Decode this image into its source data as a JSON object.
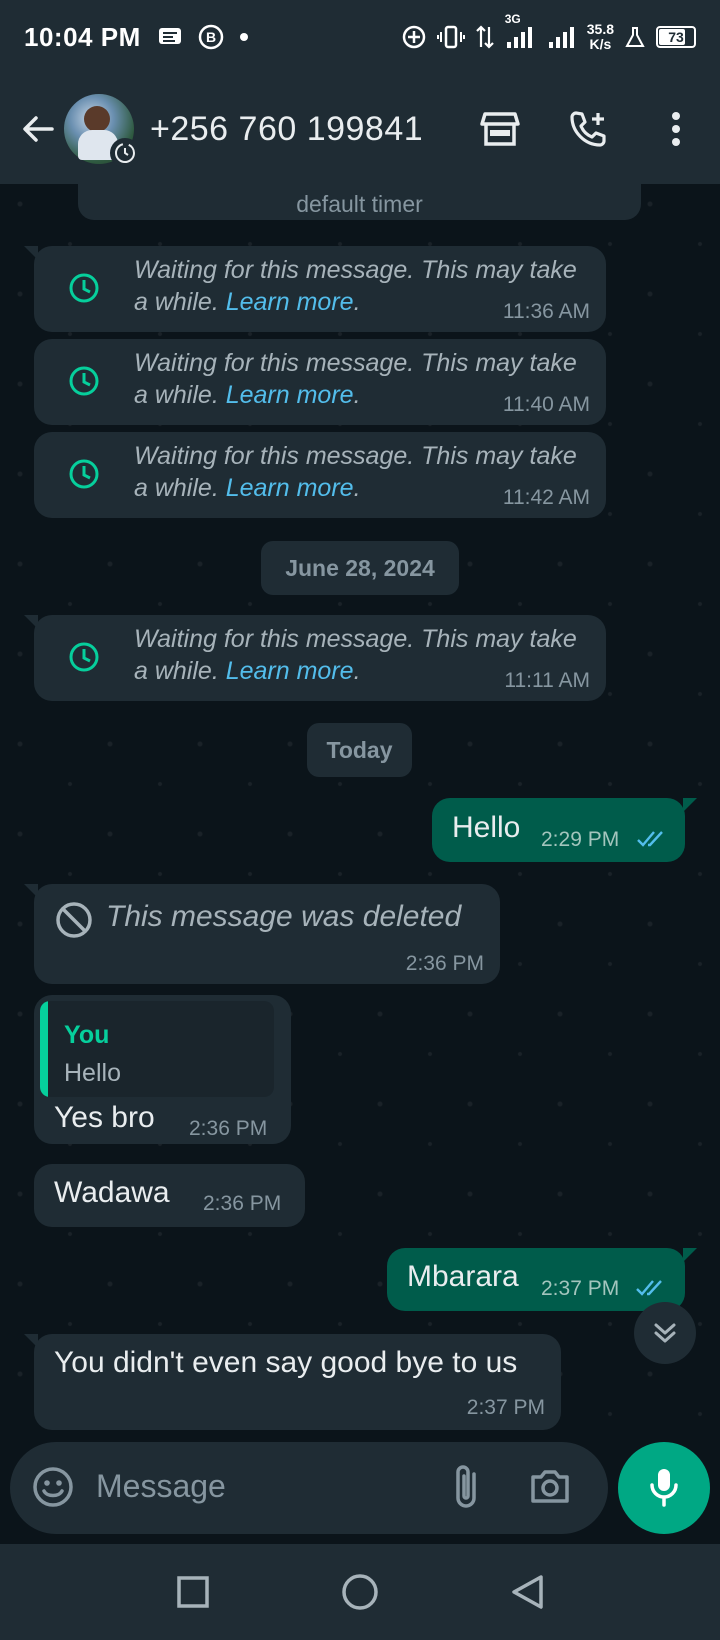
{
  "status_bar": {
    "time": "10:04 PM",
    "network_type": "3G",
    "speed_value": "35.8",
    "speed_unit": "K/s",
    "battery": "73"
  },
  "header": {
    "contact": "+256 760 199841"
  },
  "chat": {
    "timer_notice": "default timer",
    "waiting_messages": [
      {
        "text": "Waiting for this message. This may take a while.",
        "link": "Learn more",
        "time": "11:36 AM"
      },
      {
        "text": "Waiting for this message. This may take a while.",
        "link": "Learn more",
        "time": "11:40 AM"
      },
      {
        "text": "Waiting for this message. This may take a while.",
        "link": "Learn more",
        "time": "11:42 AM"
      },
      {
        "text": "Waiting for this message. This may take a while.",
        "link": "Learn more",
        "time": "11:11 AM"
      }
    ],
    "date_chips": [
      "June 28, 2024",
      "Today"
    ],
    "messages": [
      {
        "direction": "out",
        "text": "Hello",
        "time": "2:29 PM"
      },
      {
        "direction": "in",
        "text": "This message was deleted",
        "time": "2:36 PM"
      },
      {
        "direction": "in",
        "reply_to_author": "You",
        "reply_to_text": "Hello",
        "text": "Yes bro",
        "time": "2:36 PM"
      },
      {
        "direction": "in",
        "text": "Wadawa",
        "time": "2:36 PM"
      },
      {
        "direction": "out",
        "text": "Mbarara",
        "time": "2:37 PM"
      },
      {
        "direction": "in",
        "text": "You didn't even say good bye to us",
        "time": "2:37 PM"
      }
    ]
  },
  "composer": {
    "placeholder": "Message"
  },
  "colors": {
    "background": "#0b141a",
    "bubble_in": "#1f2c34",
    "bubble_out": "#005c4b",
    "accent": "#00a884",
    "link": "#53bdeb",
    "read_ticks": "#53bdeb"
  }
}
